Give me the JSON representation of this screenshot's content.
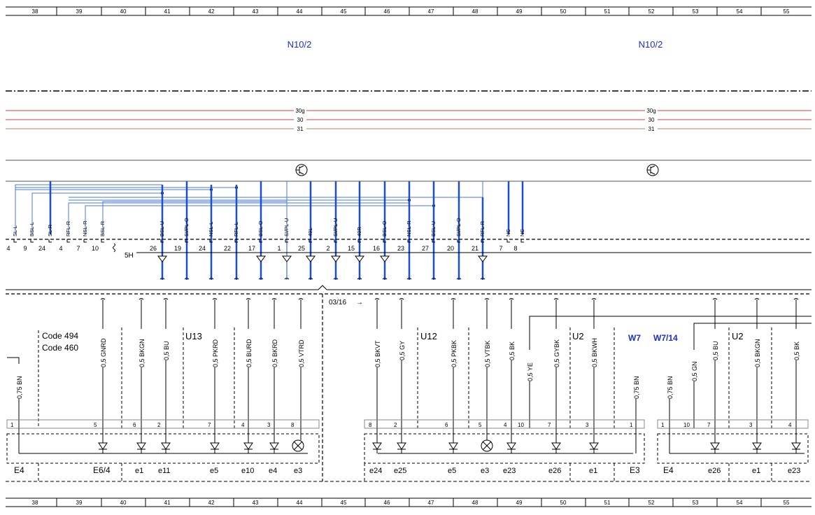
{
  "ruler": {
    "columns": [
      "38",
      "39",
      "40",
      "41",
      "42",
      "43",
      "44",
      "45",
      "46",
      "47",
      "48",
      "49",
      "50",
      "51",
      "52",
      "53",
      "54",
      "55"
    ]
  },
  "modules": {
    "left": "N10/2",
    "right": "N10/2"
  },
  "bus": {
    "labels_left": [
      "30g",
      "30",
      "31"
    ],
    "labels_right": [
      "30g",
      "30",
      "31"
    ],
    "colors": [
      "#d24040",
      "#d24040",
      "#b08060"
    ]
  },
  "connector": {
    "signals": [
      "SL-L",
      "BSL-L",
      "SL-R",
      "RFL-R",
      "NSL-R",
      "BSL-R",
      "BSL-U",
      "SI/PL-O",
      "NSL-L",
      "RFL-L",
      "BSL-O",
      "SI/PL-U",
      "49L",
      "SI/PL-U",
      "49R",
      "BSL-O",
      "NSL-R",
      "BSL-U",
      "SI/PL-O",
      "RFL-R",
      "NC",
      "NC"
    ],
    "pins": [
      "4",
      "9",
      "24",
      "4",
      "7",
      "10",
      "26",
      "19",
      "24",
      "22",
      "17",
      "1",
      "25",
      "2",
      "15",
      "16",
      "23",
      "27",
      "20",
      "21",
      "7",
      "8"
    ],
    "name": "5H",
    "page_ref": "03/16",
    "page_ref_arrow": "→"
  },
  "groups": {
    "code_lines": [
      "Code 494",
      "Code 460"
    ],
    "u13": "U13",
    "u12": "U12",
    "u2_a": "U2",
    "u2_b": "U2",
    "w7": "W7",
    "w7_14": "W7/14"
  },
  "wires": [
    "0,75 BN",
    "0,5 GNRD",
    "0,5 BKGN",
    "0,5 BU",
    "0,5 PKRD",
    "0,5 BURD",
    "0,5 BKRD",
    "0,5 VTRD",
    "0,5 BKVT",
    "0,5 GY",
    "0,5 PKBK",
    "0,5 VTBK",
    "0,5 BK",
    "0,5 YE",
    "0,5 GYBK",
    "0,5 BKWH",
    "0,75 BN",
    "0,75 BN",
    "0,5 GN",
    "0,5 BU",
    "0,5 BKGN",
    "0,5 BK"
  ],
  "lamp_pins": [
    "1",
    "5",
    "6",
    "2",
    "7",
    "4",
    "3",
    "8",
    "8",
    "2",
    "6",
    "5",
    "4",
    "10",
    "7",
    "3",
    "1",
    "1",
    "10",
    "7",
    "3",
    "4"
  ],
  "components": [
    "E4",
    "E6/4",
    "e1",
    "e11",
    "e5",
    "e10",
    "e4",
    "e3",
    "e24",
    "e25",
    "e5",
    "e3",
    "e23",
    "e26",
    "e1",
    "E3",
    "E4",
    "e26",
    "e1",
    "e23"
  ],
  "colors": {
    "blue_wire": "#1a4fd0",
    "thin_blue": "#4a78e0",
    "label_blue": "#1a2fd0",
    "black": "#000000"
  }
}
